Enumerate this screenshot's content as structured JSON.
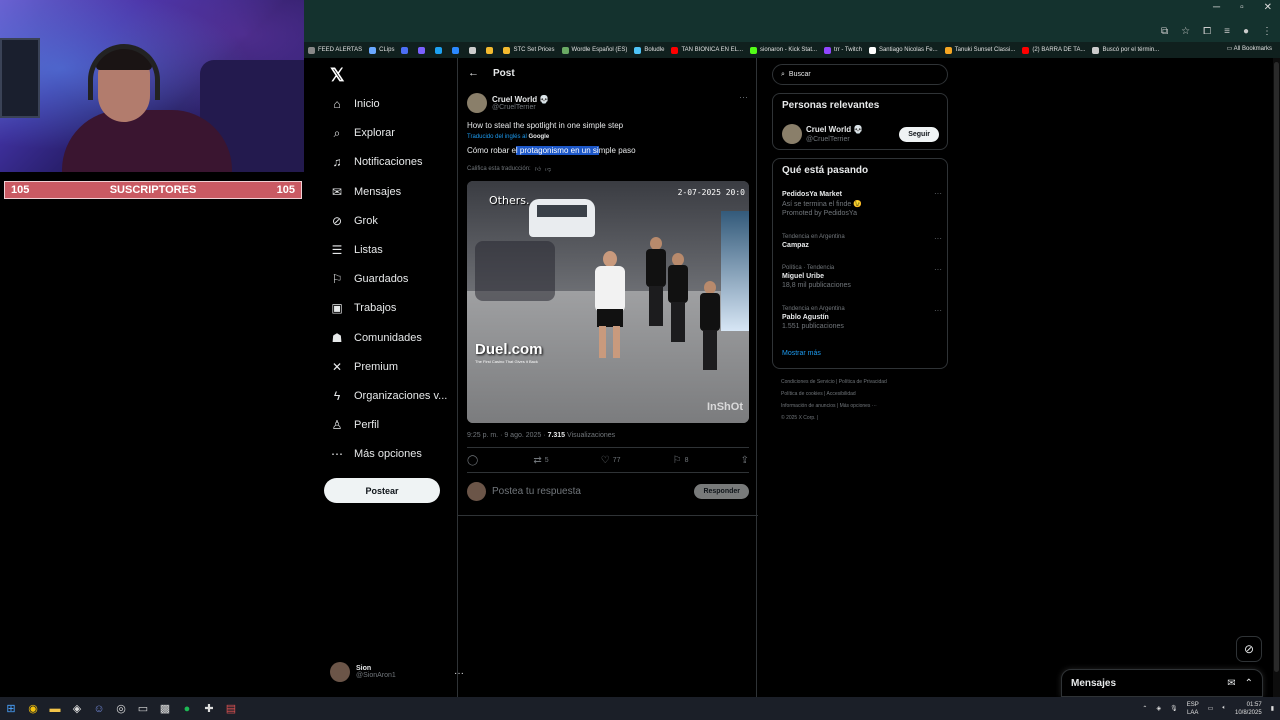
{
  "overlay": {
    "sub_count_left": "105",
    "sub_label": "SUSCRIPTORES",
    "sub_count_right": "105"
  },
  "browser": {
    "bookmarks": [
      {
        "label": "FEED ALERTAS",
        "color": "#888888"
      },
      {
        "label": "CLips",
        "color": "#6aa8ff"
      },
      {
        "label": "",
        "color": "#4c6ef5"
      },
      {
        "label": "",
        "color": "#7b61ff"
      },
      {
        "label": "",
        "color": "#1da1f2"
      },
      {
        "label": "",
        "color": "#2b88ff"
      },
      {
        "label": "",
        "color": "#cccccc"
      },
      {
        "label": "",
        "color": "#f3ba2f"
      },
      {
        "label": "STC Set Prices",
        "color": "#f3ba2f"
      },
      {
        "label": "Wordle Español (ES)",
        "color": "#6aaa64"
      },
      {
        "label": "Boludle",
        "color": "#4fc3f7"
      },
      {
        "label": "TAN BIONICA EN EL...",
        "color": "#ff0000"
      },
      {
        "label": "sionaron - Kick Stat...",
        "color": "#53fc18"
      },
      {
        "label": "trr - Twitch",
        "color": "#9146ff"
      },
      {
        "label": "Santiago Nicolas Fe...",
        "color": "#ffffff"
      },
      {
        "label": "Tanuki Sunset Classi...",
        "color": "#f5a623"
      },
      {
        "label": "(2) BARRA DE TA...",
        "color": "#ff0000"
      },
      {
        "label": "Buscó por el términ...",
        "color": "#cccccc"
      }
    ],
    "all_bookmarks": "All Bookmarks"
  },
  "nav": {
    "items": [
      {
        "icon": "home-icon",
        "glyph": "⌂",
        "label": "Inicio"
      },
      {
        "icon": "search-icon",
        "glyph": "⌕",
        "label": "Explorar"
      },
      {
        "icon": "bell-icon",
        "glyph": "♫",
        "label": "Notificaciones"
      },
      {
        "icon": "mail-icon",
        "glyph": "✉",
        "label": "Mensajes"
      },
      {
        "icon": "grok-icon",
        "glyph": "⊘",
        "label": "Grok"
      },
      {
        "icon": "list-icon",
        "glyph": "☰",
        "label": "Listas"
      },
      {
        "icon": "bookmark-icon",
        "glyph": "⚐",
        "label": "Guardados"
      },
      {
        "icon": "briefcase-icon",
        "glyph": "▣",
        "label": "Trabajos"
      },
      {
        "icon": "communities-icon",
        "glyph": "☗",
        "label": "Comunidades"
      },
      {
        "icon": "x-premium-icon",
        "glyph": "✕",
        "label": "Premium"
      },
      {
        "icon": "bolt-icon",
        "glyph": "ϟ",
        "label": "Organizaciones v..."
      },
      {
        "icon": "profile-icon",
        "glyph": "♙",
        "label": "Perfil"
      },
      {
        "icon": "more-icon",
        "glyph": "⋯",
        "label": "Más opciones"
      }
    ],
    "post_button": "Postear",
    "me_name": "Sion",
    "me_handle": "@SionAron1"
  },
  "post": {
    "header_title": "Post",
    "author_name": "Cruel World 💀",
    "author_handle": "@CruelTerrier",
    "original_text": "How to steal the spotlight in one simple step",
    "translated_by_prefix": "Traducido del inglés al",
    "translated_by_brand": "Google",
    "translated_text_a": "Cómo robar e",
    "translated_text_hl": "l protagonismo en un si",
    "translated_text_b": "mple paso",
    "rate_prompt": "Califica esta traducción:",
    "video_overlay_others": "Others.",
    "video_timestamp": "2-07-2025  20:0",
    "video_watermark": "Duel.com",
    "video_watermark_sub": "The First Casino That Gives it Back",
    "video_inshot": "InShOt",
    "time": "9:25 p. m. · 9 ago. 2025 ·",
    "views_count": "7.315",
    "views_label": "Visualizaciones",
    "replies": "",
    "reposts": "5",
    "likes": "77",
    "bookmarks": "8",
    "reply_placeholder": "Postea tu respuesta",
    "reply_button": "Responder"
  },
  "right": {
    "search_placeholder": "Buscar",
    "relevant_title": "Personas relevantes",
    "relevant_name": "Cruel World 💀",
    "relevant_handle": "@CruelTerrier",
    "follow_button": "Seguir",
    "trending_title": "Qué está pasando",
    "trends": [
      {
        "context": "",
        "title": "PedidosYa Market",
        "sub": "Así se termina el finde 😉",
        "promo": "Promoted by PedidosYa"
      },
      {
        "context": "Tendencia en Argentina",
        "title": "Campaz",
        "sub": "",
        "promo": ""
      },
      {
        "context": "Política · Tendencia",
        "title": "Miguel Uribe",
        "sub": "18,8 mil publicaciones",
        "promo": ""
      },
      {
        "context": "Tendencia en Argentina",
        "title": "Pablo Agustín",
        "sub": "1.551 publicaciones",
        "promo": ""
      }
    ],
    "show_more": "Mostrar más",
    "footer": [
      "Condiciones de Servicio",
      "Política de Privacidad",
      "Política de cookies",
      "Accesibilidad",
      "Información de anuncios",
      "Más opciones ···",
      "© 2025 X Corp."
    ]
  },
  "messages_bar": {
    "title": "Mensajes"
  },
  "taskbar": {
    "lang_a": "ESP",
    "lang_b": "LAA",
    "time": "01:57",
    "date": "10/8/2025"
  }
}
